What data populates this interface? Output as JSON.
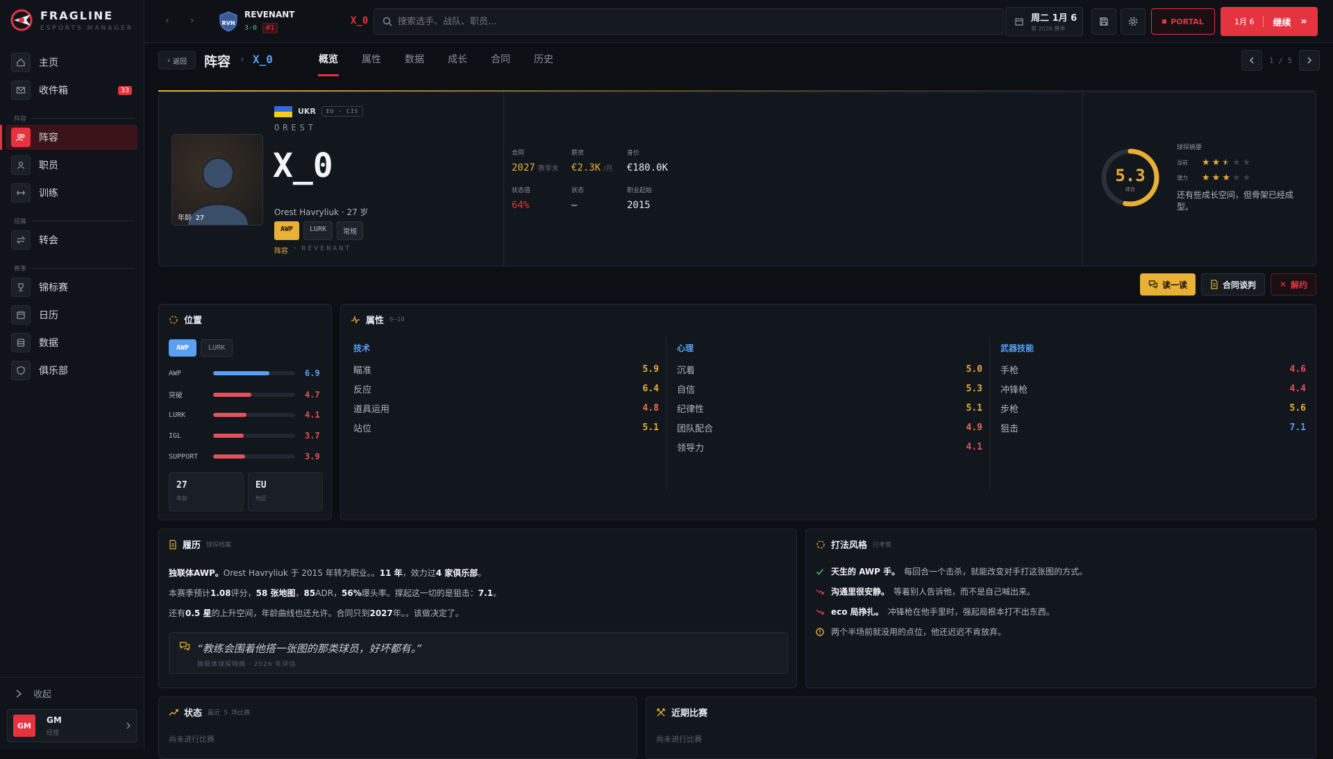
{
  "app": {
    "name": "FRAGLINE",
    "tagline": "ESPORTS MANAGER"
  },
  "sidebar": {
    "items": [
      {
        "label": "主页",
        "icon": "home-icon"
      },
      {
        "label": "收件箱",
        "icon": "mail-icon",
        "badge": "33"
      },
      {
        "label": "阵容",
        "icon": "users-icon"
      },
      {
        "label": "职员",
        "icon": "person-icon"
      },
      {
        "label": "训练",
        "icon": "dumbbell-icon"
      },
      {
        "label": "转会",
        "icon": "transfer-icon"
      },
      {
        "label": "锦标赛",
        "icon": "trophy-icon"
      },
      {
        "label": "日历",
        "icon": "calendar-icon"
      },
      {
        "label": "数据",
        "icon": "database-icon"
      },
      {
        "label": "俱乐部",
        "icon": "shield-icon"
      }
    ],
    "sections": {
      "squad": "阵容",
      "recruit": "招募",
      "events": "赛事"
    },
    "collapse": "收起",
    "user": {
      "avatar": "GM",
      "name": "GM",
      "role": "经理"
    }
  },
  "topbar": {
    "team": {
      "abbr": "RVN",
      "name": "REVENANT",
      "record": "3-0",
      "rank": "#1"
    },
    "player": "X_0",
    "search_placeholder": "搜索选手、战队、职员...",
    "date": {
      "main": "周二  1月 6",
      "sub": "第 2026 赛季"
    },
    "portal": "PORTAL",
    "continue": {
      "date": "1月 6",
      "label": "继续"
    }
  },
  "subnav": {
    "back": "返回",
    "crumb": "阵容",
    "player": "X_0",
    "tabs": [
      "概览",
      "属性",
      "数据",
      "成长",
      "合同",
      "历史"
    ],
    "pager": "1 / 5"
  },
  "hero": {
    "nationality": "UKR",
    "region": "EU · CIS",
    "first_name": "OREST",
    "nickname": "X_0",
    "full_line": "Orest Havryliuk · 27 岁",
    "age_label": "年龄",
    "age": "27",
    "roles": [
      "AWP",
      "LURK",
      "常规"
    ],
    "team_role": "阵容",
    "team_name": "REVENANT",
    "stats": [
      {
        "label": "合同",
        "value": "2027",
        "unit": "赛季末",
        "color": "#e8b035"
      },
      {
        "label": "薪资",
        "value": "€2.3K",
        "unit": "/月",
        "color": "#e8b035"
      },
      {
        "label": "身价",
        "value": "€180.0K",
        "unit": "",
        "color": "#e8ecf0"
      },
      {
        "label": "状态值",
        "value": "64%",
        "unit": "",
        "color": "#e5343f"
      },
      {
        "label": "状态",
        "value": "—",
        "unit": "",
        "color": "#e8ecf0"
      },
      {
        "label": "职业起始",
        "value": "2015",
        "unit": "",
        "color": "#e8ecf0"
      }
    ],
    "rating": {
      "value": "5.3",
      "label": "综合",
      "fraction": 0.53
    },
    "scout": {
      "title": "球探摘要",
      "current_label": "当前",
      "current_stars": 2.5,
      "potential_label": "潜力",
      "potential_stars": 3,
      "note": "还有些成长空间，但骨架已经成型。"
    }
  },
  "actions": {
    "read": "读一读",
    "contract": "合同谈判",
    "release": "解约"
  },
  "position": {
    "title": "位置",
    "tabs": [
      "AWP",
      "LURK"
    ],
    "rows": [
      {
        "name": "AWP",
        "value": 6.9,
        "text": "6.9",
        "color": "#5aa0f2"
      },
      {
        "name": "突破",
        "value": 4.7,
        "text": "4.7",
        "color": "#e5505a"
      },
      {
        "name": "LURK",
        "value": 4.1,
        "text": "4.1",
        "color": "#e5505a"
      },
      {
        "name": "IGL",
        "value": 3.7,
        "text": "3.7",
        "color": "#e5505a"
      },
      {
        "name": "SUPPORT",
        "value": 3.9,
        "text": "3.9",
        "color": "#e5505a"
      }
    ],
    "age": {
      "value": "27",
      "label": "年龄"
    },
    "region": {
      "value": "EU",
      "label": "地区"
    }
  },
  "attributes": {
    "title": "属性",
    "range": "0–10",
    "groups": [
      {
        "name": "技术",
        "items": [
          {
            "name": "瞄准",
            "value": "5.9",
            "color": "#e8b035"
          },
          {
            "name": "反应",
            "value": "6.4",
            "color": "#e8b035"
          },
          {
            "name": "道具运用",
            "value": "4.8",
            "color": "#e8704a"
          },
          {
            "name": "站位",
            "value": "5.1",
            "color": "#e8b035"
          }
        ]
      },
      {
        "name": "心理",
        "items": [
          {
            "name": "沉着",
            "value": "5.0",
            "color": "#e8b035"
          },
          {
            "name": "自信",
            "value": "5.3",
            "color": "#e8b035"
          },
          {
            "name": "纪律性",
            "value": "5.1",
            "color": "#e8b035"
          },
          {
            "name": "团队配合",
            "value": "4.9",
            "color": "#e8704a"
          },
          {
            "name": "领导力",
            "value": "4.1",
            "color": "#e5505a"
          }
        ]
      },
      {
        "name": "武器技能",
        "items": [
          {
            "name": "手枪",
            "value": "4.6",
            "color": "#e5505a"
          },
          {
            "name": "冲锋枪",
            "value": "4.4",
            "color": "#e5505a"
          },
          {
            "name": "步枪",
            "value": "5.6",
            "color": "#e8b035"
          },
          {
            "name": "狙击",
            "value": "7.1",
            "color": "#5aa0f2"
          }
        ]
      }
    ]
  },
  "bio": {
    "title": "履历",
    "sub": "球探档案",
    "l1": {
      "a": "独联体AWP。",
      "b": "Orest Havryliuk 于 2015 年转为职业。。",
      "c": "11 年",
      "d": "，效力过",
      "e": "4 家俱乐部",
      "f": "。"
    },
    "l2": {
      "a": "本赛季预计",
      "b": "1.08",
      "c": "评分，",
      "d": "58 张地图",
      "e": "，",
      "f": "85",
      "g": "ADR，",
      "h": "56%",
      "i": "爆头率。撑起这一切的是狙击：",
      "j": "7.1",
      "k": "。"
    },
    "l3": {
      "a": "还有",
      "b": "0.5 星",
      "c": "的上升空间，年龄曲线也还允许。合同只到",
      "d": "2027",
      "e": "年。。该做决定了。"
    },
    "quote": "“教练会围着他搭一张图的那类球员，好坏都有。”",
    "quote_src": "独联体球探网络  ·  2026 年评估"
  },
  "playstyle": {
    "title": "打法风格",
    "sub": "已考察",
    "items": [
      {
        "bold": "天生的 AWP 手。",
        "text": "每回合一个击杀，就能改变对手打这张图的方式。",
        "icon": "check-icon",
        "color": "#4fc06b"
      },
      {
        "bold": "沟通里很安静。",
        "text": "等着别人告诉他，而不是自己喊出来。",
        "icon": "trend-down-icon",
        "color": "#e5343f"
      },
      {
        "bold": "eco 局挣扎。",
        "text": "冲锋枪在他手里时，强起局根本打不出东西。",
        "icon": "trend-down-icon",
        "color": "#e5343f"
      },
      {
        "bold": "",
        "text": "两个半场前就没用的点位，他还迟迟不肯放弃。",
        "icon": "alert-icon",
        "color": "#e8b035"
      }
    ]
  },
  "form": {
    "title": "状态",
    "sub": "最近 5 场比赛",
    "empty": "尚未进行比赛"
  },
  "recent": {
    "title": "近期比赛",
    "empty": "尚未进行比赛"
  }
}
